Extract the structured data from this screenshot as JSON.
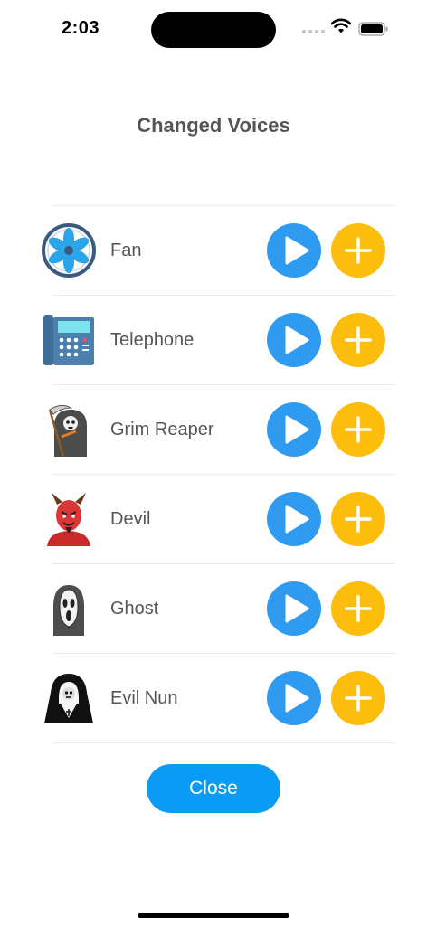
{
  "status_bar": {
    "time": "2:03",
    "icons": [
      "cellular-icon",
      "wifi-icon",
      "battery-icon"
    ]
  },
  "title": "Changed Voices",
  "colors": {
    "play": "#2e9bf1",
    "add": "#fdbd0d",
    "close": "#0a9bf5",
    "text": "#555555",
    "divider": "#e8e8e8"
  },
  "voices": [
    {
      "label": "Fan",
      "icon": "fan-icon"
    },
    {
      "label": "Telephone",
      "icon": "telephone-icon"
    },
    {
      "label": "Grim Reaper",
      "icon": "grim-reaper-icon"
    },
    {
      "label": "Devil",
      "icon": "devil-icon"
    },
    {
      "label": "Ghost",
      "icon": "ghost-icon"
    },
    {
      "label": "Evil Nun",
      "icon": "evil-nun-icon"
    }
  ],
  "close_label": "Close"
}
